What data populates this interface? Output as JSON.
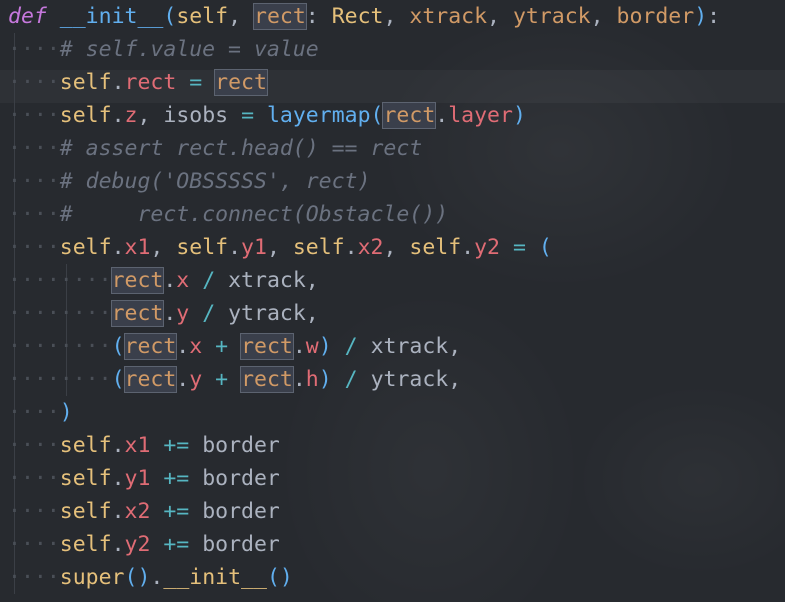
{
  "editor": {
    "language": "python",
    "lines": [
      {
        "text": "def __init__(self, rect: Rect, xtrack, ytrack, border):"
      },
      {
        "text": "    # self.value = value"
      },
      {
        "text": "    self.rect = rect"
      },
      {
        "text": "    self.z, isobs = layermap(rect.layer)"
      },
      {
        "text": "    # assert rect.head() == rect"
      },
      {
        "text": "    # debug('OBSSSSS', rect)"
      },
      {
        "text": "    #     rect.connect(Obstacle())"
      },
      {
        "text": "    self.x1, self.y1, self.x2, self.y2 = ("
      },
      {
        "text": "        rect.x / xtrack,"
      },
      {
        "text": "        rect.y / ytrack,"
      },
      {
        "text": "        (rect.x + rect.w) / xtrack,"
      },
      {
        "text": "        (rect.y + rect.h) / ytrack,"
      },
      {
        "text": "    )"
      },
      {
        "text": "    self.x1 += border"
      },
      {
        "text": "    self.y1 += border"
      },
      {
        "text": "    self.x2 += border"
      },
      {
        "text": "    self.y2 += border"
      },
      {
        "text": "    super().__init__()"
      }
    ],
    "highlighted_symbol": "rect"
  },
  "colors": {
    "background": "#272a2f",
    "keyword": "#c678dd",
    "function": "#61afef",
    "self": "#e5c07b",
    "attribute": "#e06c75",
    "parameter": "#d19a66",
    "operator": "#56b6c2",
    "comment": "#6b7280"
  }
}
